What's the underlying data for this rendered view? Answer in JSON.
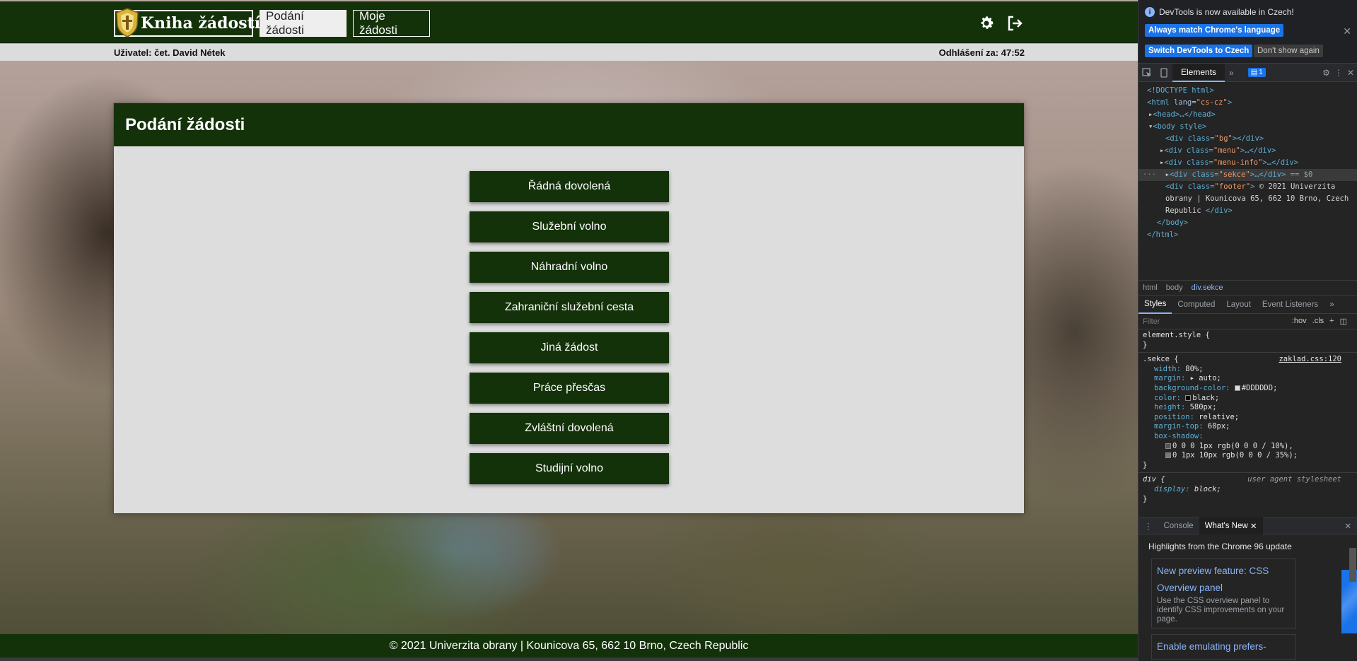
{
  "app": {
    "logo_text": "Kniha žádostí",
    "nav": [
      {
        "label": "Podání žádosti",
        "active": true
      },
      {
        "label": "Moje žádosti",
        "active": false
      }
    ],
    "icons": {
      "settings": "gear-icon",
      "logout": "logout-icon"
    }
  },
  "infobar": {
    "user_label": "Uživatel:",
    "user_name": "čet. David Nétek",
    "timer_label": "Odhlášení za:",
    "timer_value": "47:52"
  },
  "section": {
    "title": "Podání žádosti",
    "buttons": [
      "Řádná dovolená",
      "Služební volno",
      "Náhradní volno",
      "Zahraniční služební cesta",
      "Jiná žádost",
      "Práce přesčas",
      "Zvláštní dovolená",
      "Studijní volno"
    ]
  },
  "footer": {
    "text": "© 2021 Univerzita obrany | Kounicova 65, 662 10 Brno, Czech Republic"
  },
  "colors": {
    "brand_green": "#14320a",
    "panel_gray": "#dddddd"
  },
  "devtools": {
    "notice": "DevTools is now available in Czech!",
    "btn_match": "Always match Chrome's language",
    "btn_switch": "Switch DevTools to Czech",
    "btn_dismiss": "Don't show again",
    "tab_elements": "Elements",
    "issues_count": "1",
    "dom": {
      "doctype": "<!DOCTYPE html>",
      "html_open_tag": "<html",
      "html_lang_attr": "lang",
      "html_lang_val": "\"cs-cz\"",
      "head": "<head>…</head>",
      "body_open": "<body style>",
      "div_bg_open": "<div class=",
      "div_bg_class": "\"bg\"",
      "div_close": "></div>",
      "div_menu_class": "\"menu\"",
      "div_menuinfo_class": "\"menu-info\"",
      "div_sekce_class": "\"sekce\"",
      "ellipsis_close": ">…</div>",
      "selected_marker": "== $0",
      "div_footer_class": "\"footer\"",
      "footer_text_1": " © 2021 Univerzita",
      "footer_text_2": "obrany | Kounicova 65, 662 10 Brno, Czech",
      "footer_text_3": "Republic ",
      "close_div": "</div>",
      "close_body": "</body>",
      "close_html": "</html>"
    },
    "crumbs": [
      "html",
      "body",
      "div.sekce"
    ],
    "style_tabs": [
      "Styles",
      "Computed",
      "Layout",
      "Event Listeners"
    ],
    "filter_placeholder": "Filter",
    "filter_hov": ":hov",
    "filter_cls": ".cls",
    "rules": {
      "element_style": "element.style {",
      "close": "}",
      "sekce_selector": ".sekce {",
      "sekce_source": "zaklad.css:120",
      "props": [
        {
          "name": "width",
          "value": "80%;"
        },
        {
          "name": "margin",
          "value": "▸ auto;"
        },
        {
          "name": "background-color",
          "value": "#DDDDDD;"
        },
        {
          "name": "color",
          "value": "black;"
        },
        {
          "name": "height",
          "value": "580px;"
        },
        {
          "name": "position",
          "value": "relative;"
        },
        {
          "name": "margin-top",
          "value": "60px;"
        },
        {
          "name": "box-shadow",
          "value": ""
        }
      ],
      "shadow_1": "0 0 0 1px rgb(0 0 0 / 10%),",
      "shadow_2": "0 1px 10px rgb(0 0 0 / 35%);",
      "div_selector": "div {",
      "div_source": "user agent stylesheet",
      "div_prop_name": "display",
      "div_prop_value": "block;"
    },
    "drawer_tabs": [
      "Console",
      "What's New"
    ],
    "whatsnew_head": "Highlights from the Chrome 96 update",
    "cards": [
      {
        "title_1": "New preview feature: CSS",
        "title_2": "Overview panel",
        "desc": "Use the CSS overview panel to identify CSS improvements on your page."
      },
      {
        "title_1": "Enable emulating prefers-",
        "title_2": "",
        "desc": ""
      }
    ]
  }
}
